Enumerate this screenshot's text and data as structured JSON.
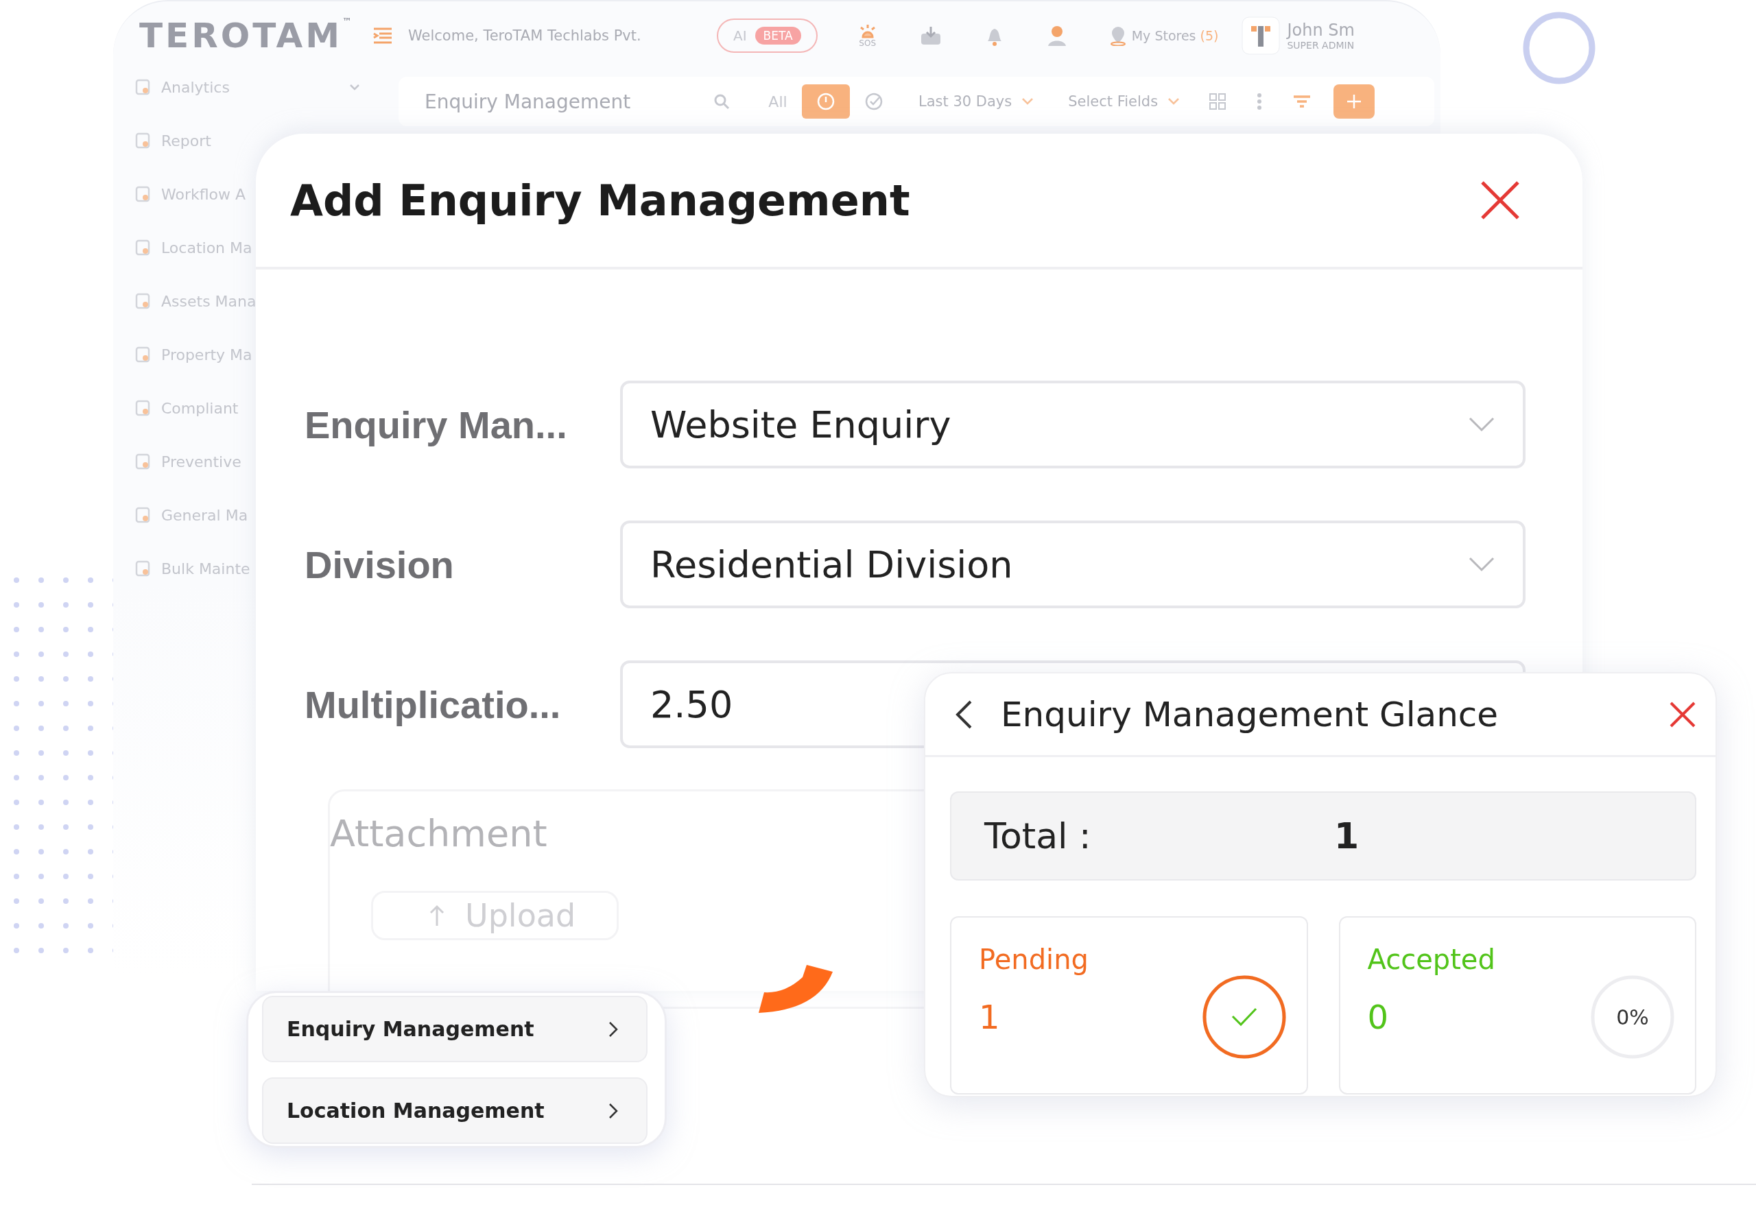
{
  "app": {
    "logo": "TEROTAM",
    "logo_mark": "™",
    "welcome": "Welcome, TeroTAM Techlabs Pvt.",
    "ai_badge": {
      "label": "AI",
      "tag": "BETA"
    },
    "sos_label": "SOS",
    "stores": {
      "label": "My Stores",
      "count": "(5)"
    },
    "user": {
      "name": "John Sm",
      "role": "SUPER ADMIN"
    }
  },
  "sidebar": {
    "items": [
      {
        "label": "Analytics",
        "kind": "group"
      },
      {
        "label": "Report",
        "kind": "link"
      },
      {
        "label": "Workflow A",
        "kind": "link"
      },
      {
        "label": "Location Ma",
        "kind": "link"
      },
      {
        "label": "Assets Mana",
        "kind": "link"
      },
      {
        "label": "Property Ma",
        "kind": "link"
      },
      {
        "label": "Compliant",
        "kind": "link"
      },
      {
        "label": "Preventive",
        "kind": "link"
      },
      {
        "label": "General Ma",
        "kind": "link"
      },
      {
        "label": "Bulk Mainte",
        "kind": "link"
      }
    ]
  },
  "toolbar": {
    "title": "Enquiry Management",
    "filters": [
      {
        "kind": "text",
        "label": "All",
        "selected": false
      },
      {
        "kind": "clock",
        "selected": true
      },
      {
        "kind": "check",
        "selected": false
      }
    ],
    "range": "Last 30 Days",
    "fields": "Select Fields"
  },
  "modal": {
    "title": "Add Enquiry Management",
    "fields": [
      {
        "label": "Enquiry Man...",
        "kind": "select",
        "value": "Website Enquiry"
      },
      {
        "label": "Division",
        "kind": "select",
        "value": "Residential Division"
      },
      {
        "label": "Multiplicatio...",
        "kind": "input",
        "value": "2.50"
      }
    ],
    "attachment": {
      "label": "Attachment",
      "button": "Upload"
    }
  },
  "glance": {
    "title": "Enquiry Management Glance",
    "total_label": "Total :",
    "total": "1",
    "cards": [
      {
        "label": "Pending",
        "value": "1",
        "color": "#f26b21",
        "level": 1,
        "kind": "check"
      },
      {
        "label": "Accepted",
        "value": "0",
        "color": "#52c41a",
        "level": 0,
        "kind": "percent",
        "reading": "0%"
      }
    ]
  },
  "menu": {
    "items": [
      {
        "label": "Enquiry Management"
      },
      {
        "label": "Location Management"
      }
    ]
  }
}
